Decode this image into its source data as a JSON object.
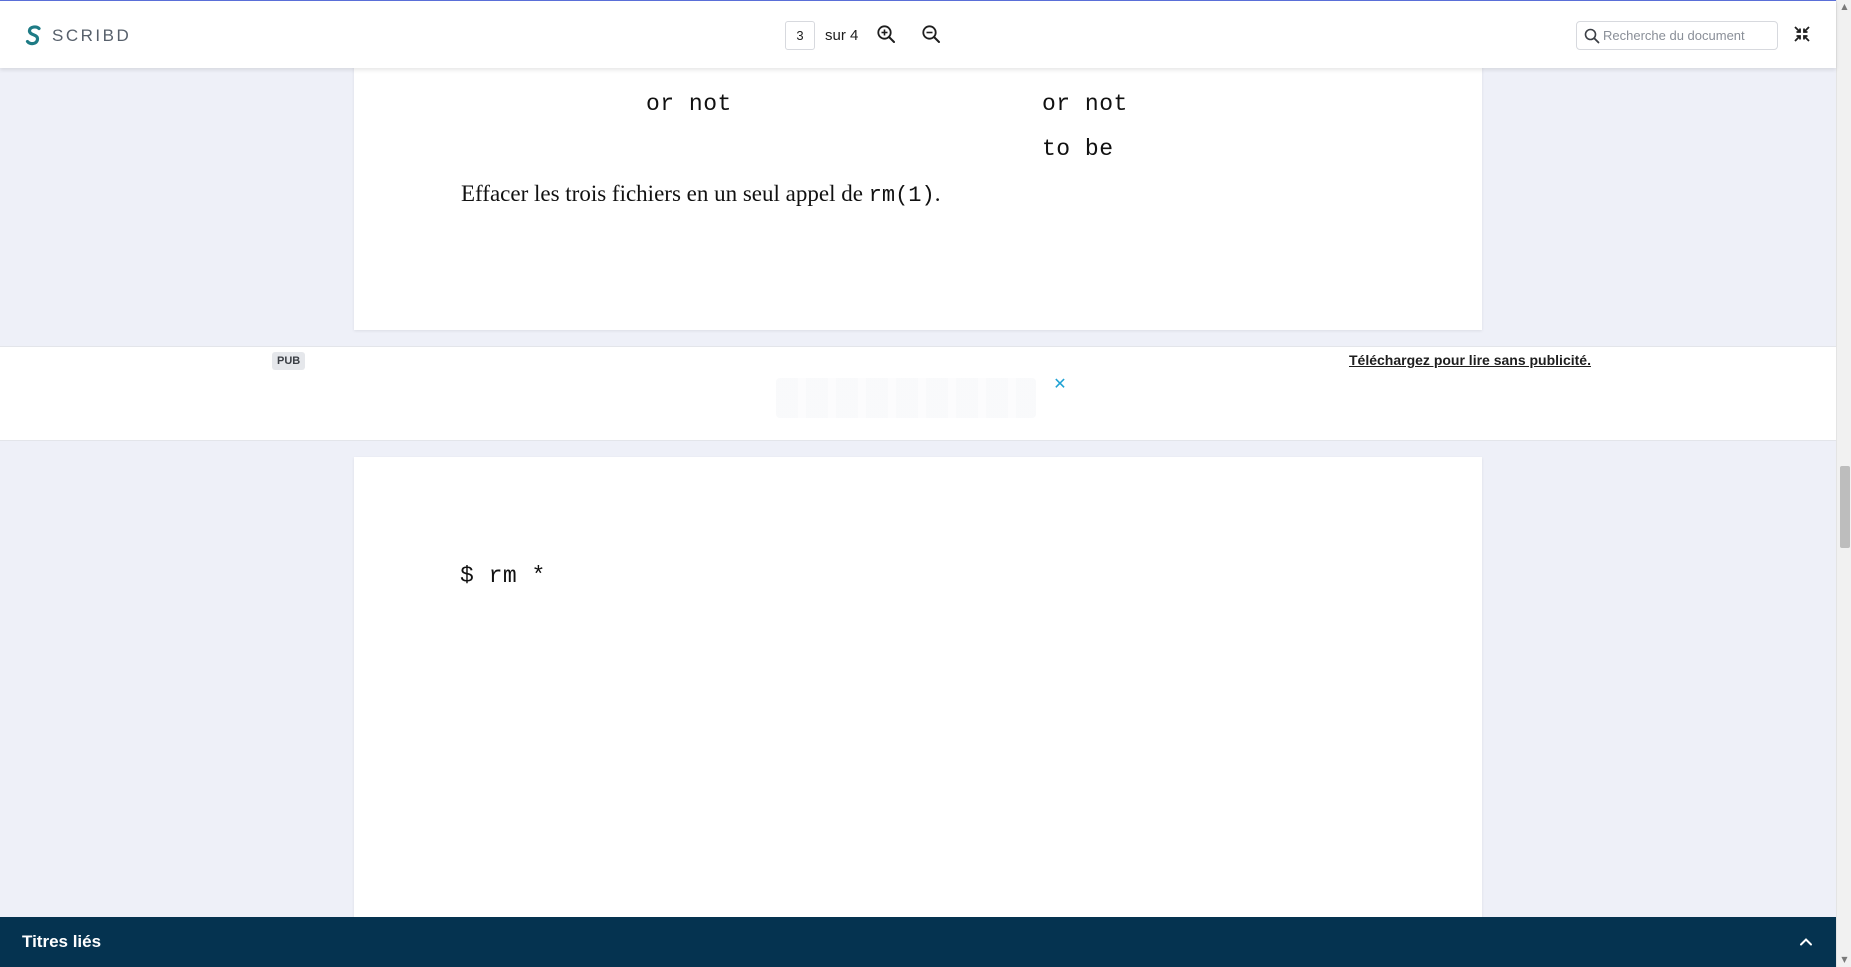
{
  "app": {
    "logo_text": "SCRIBD",
    "brand_color": "#1e7b85"
  },
  "toolbar": {
    "current_page": "3",
    "page_total": "sur 4",
    "zoom_in_icon": "zoom-in-icon",
    "zoom_out_icon": "zoom-out-icon",
    "search_placeholder": "Recherche du document",
    "collapse_icon": "collapse-fullscreen-icon"
  },
  "document": {
    "page3": {
      "line1_left": "or not",
      "line1_right": "or not",
      "line2_right": "to be",
      "sentence_text": "Effacer les trois fichiers en un seul appel de ",
      "sentence_code": "rm(1)",
      "sentence_end": "."
    },
    "page4": {
      "command": "$ rm *"
    }
  },
  "ad": {
    "badge": "PUB",
    "link_text": "Téléchargez pour lire sans publicité.",
    "close_symbol": "✕"
  },
  "related": {
    "title": "Titres liés"
  },
  "colors": {
    "header_bg": "#ffffff",
    "canvas_bg": "#eef0f8",
    "related_bar_bg": "#053350",
    "ad_close": "#1fa2d4"
  }
}
